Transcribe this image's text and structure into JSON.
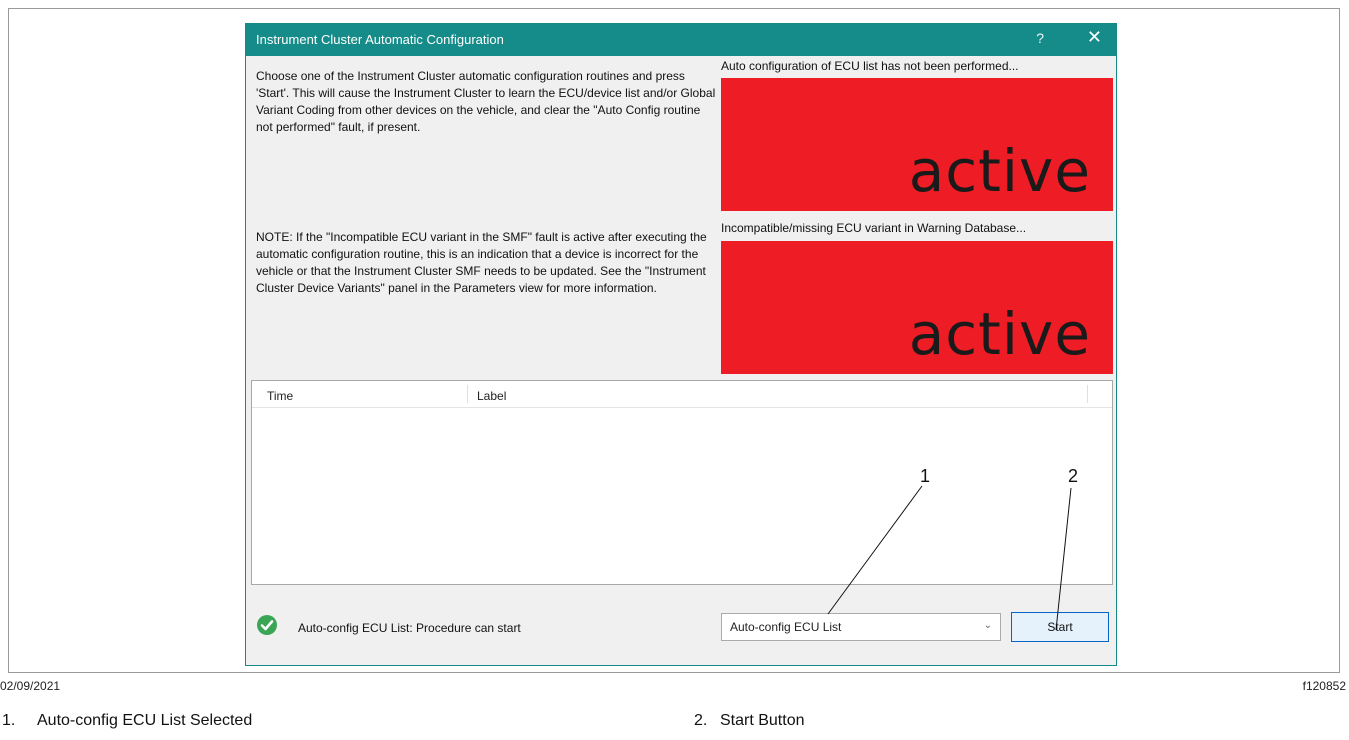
{
  "window": {
    "title": "Instrument Cluster Automatic Configuration",
    "help_label": "?",
    "close_label": "✕"
  },
  "instructions": "Choose one of the Instrument Cluster automatic configuration routines and press 'Start'. This will cause the Instrument Cluster to learn the ECU/device list and/or Global Variant Coding from other devices on the vehicle, and clear the \"Auto Config routine not performed\" fault, if present.",
  "note": "NOTE: If the \"Incompatible ECU variant in the SMF\" fault is active after executing the automatic configuration routine, this is an indication that a device is incorrect for the vehicle or that the Instrument Cluster SMF needs to be updated.  See the \"Instrument Cluster Device Variants\" panel in the Parameters view for more information.",
  "status_panels": [
    {
      "caption": "Auto configuration of ECU list has not been performed...",
      "state": "active",
      "color": "#ee1c24"
    },
    {
      "caption": "Incompatible/missing ECU variant in Warning Database...",
      "state": "active",
      "color": "#ee1c24"
    }
  ],
  "log": {
    "columns": [
      "Time",
      "Label"
    ],
    "rows": []
  },
  "footer": {
    "status_icon": "check-circle-icon",
    "status_message": "Auto-config ECU List: Procedure can start",
    "routine_select_value": "Auto-config ECU List",
    "start_label": "Start"
  },
  "callouts": [
    "1",
    "2"
  ],
  "figure": {
    "date": "02/09/2021",
    "code": "f120852",
    "captions": [
      {
        "num": "1.",
        "text": "Auto-config ECU List Selected"
      },
      {
        "num": "2.",
        "text": "Start Button"
      }
    ]
  }
}
